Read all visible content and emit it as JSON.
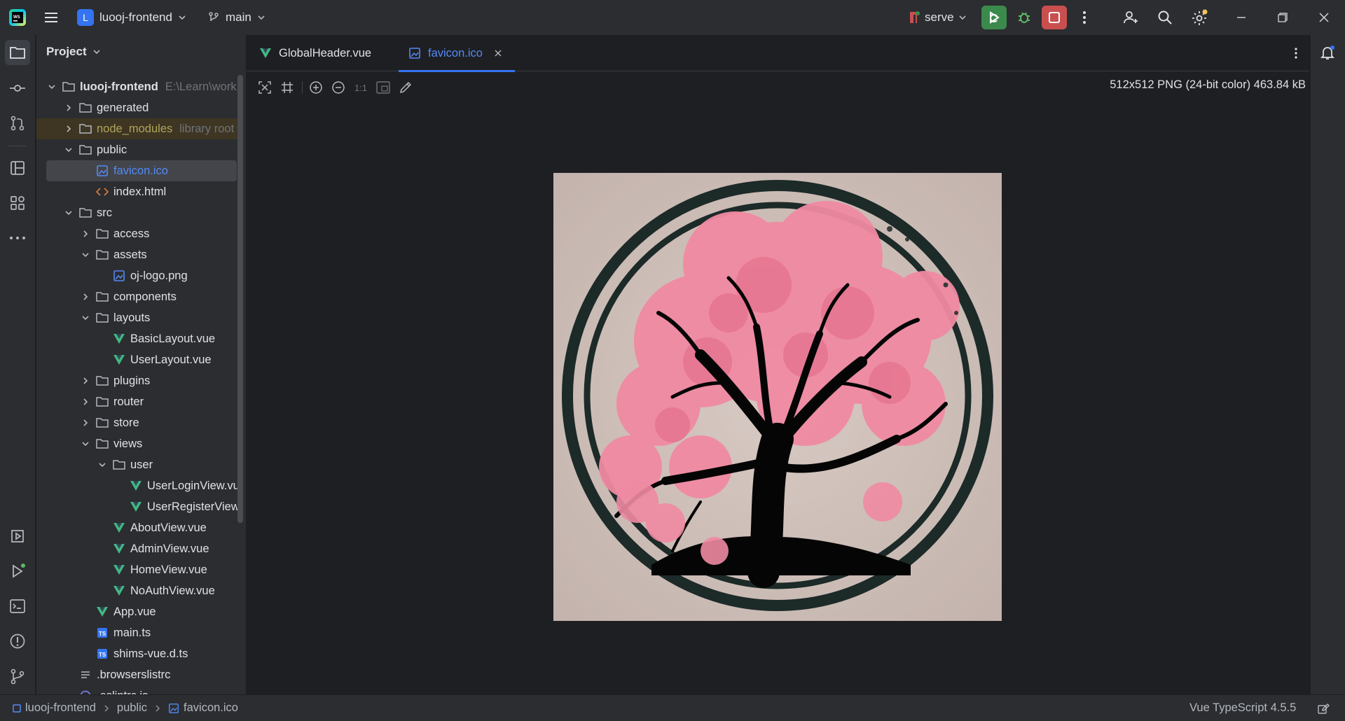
{
  "titlebar": {
    "project_initial": "L",
    "project_name": "luooj-frontend",
    "branch": "main",
    "run_config": "serve"
  },
  "project_panel": {
    "title": "Project",
    "tree": [
      {
        "label": "luooj-frontend",
        "hint": "E:\\Learn\\work",
        "level": 0,
        "type": "folder",
        "expanded": true,
        "bold": true
      },
      {
        "label": "generated",
        "level": 1,
        "type": "folder",
        "expanded": false
      },
      {
        "label": "node_modules",
        "hint": "library root",
        "level": 1,
        "type": "folder",
        "expanded": false,
        "excluded": true
      },
      {
        "label": "public",
        "level": 1,
        "type": "folder",
        "expanded": true
      },
      {
        "label": "favicon.ico",
        "level": 2,
        "type": "image",
        "selected": true
      },
      {
        "label": "index.html",
        "level": 2,
        "type": "html"
      },
      {
        "label": "src",
        "level": 1,
        "type": "folder",
        "expanded": true
      },
      {
        "label": "access",
        "level": 2,
        "type": "folder",
        "expanded": false
      },
      {
        "label": "assets",
        "level": 2,
        "type": "folder",
        "expanded": true
      },
      {
        "label": "oj-logo.png",
        "level": 3,
        "type": "image"
      },
      {
        "label": "components",
        "level": 2,
        "type": "folder",
        "expanded": false
      },
      {
        "label": "layouts",
        "level": 2,
        "type": "folder",
        "expanded": true
      },
      {
        "label": "BasicLayout.vue",
        "level": 3,
        "type": "vue"
      },
      {
        "label": "UserLayout.vue",
        "level": 3,
        "type": "vue"
      },
      {
        "label": "plugins",
        "level": 2,
        "type": "folder",
        "expanded": false
      },
      {
        "label": "router",
        "level": 2,
        "type": "folder",
        "expanded": false
      },
      {
        "label": "store",
        "level": 2,
        "type": "folder",
        "expanded": false
      },
      {
        "label": "views",
        "level": 2,
        "type": "folder",
        "expanded": true
      },
      {
        "label": "user",
        "level": 3,
        "type": "folder",
        "expanded": true
      },
      {
        "label": "UserLoginView.vue",
        "level": 4,
        "type": "vue"
      },
      {
        "label": "UserRegisterView.vue",
        "level": 4,
        "type": "vue"
      },
      {
        "label": "AboutView.vue",
        "level": 3,
        "type": "vue"
      },
      {
        "label": "AdminView.vue",
        "level": 3,
        "type": "vue"
      },
      {
        "label": "HomeView.vue",
        "level": 3,
        "type": "vue"
      },
      {
        "label": "NoAuthView.vue",
        "level": 3,
        "type": "vue"
      },
      {
        "label": "App.vue",
        "level": 2,
        "type": "vue"
      },
      {
        "label": "main.ts",
        "level": 2,
        "type": "ts"
      },
      {
        "label": "shims-vue.d.ts",
        "level": 2,
        "type": "ts"
      },
      {
        "label": ".browserslistrc",
        "level": 1,
        "type": "text"
      },
      {
        "label": ".eslintrc.js",
        "level": 1,
        "type": "js"
      }
    ]
  },
  "editor": {
    "tabs": [
      {
        "label": "GlobalHeader.vue",
        "type": "vue",
        "active": false
      },
      {
        "label": "favicon.ico",
        "type": "image",
        "active": true
      }
    ],
    "toolbar": {
      "actual_size_label": "1:1"
    },
    "image_info": "512x512 PNG (24-bit color) 463.84 kB"
  },
  "statusbar": {
    "breadcrumbs": [
      "luooj-frontend",
      "public",
      "favicon.ico"
    ],
    "language": "Vue TypeScript 4.5.5"
  },
  "colors": {
    "accent": "#3574f0",
    "vue_green": "#41b883",
    "run_green": "#3b8a4c",
    "stop_red": "#c94f4f",
    "blossom_pink": "#f08aa3"
  },
  "icons": {
    "strip_left_top": [
      "folder-icon",
      "commit-icon",
      "pull-requests-icon",
      "structure-icon",
      "plugins-icon",
      "more-icon"
    ],
    "strip_left_bottom": [
      "services-icon",
      "run-icon",
      "terminal-icon",
      "problems-icon",
      "git-icon"
    ]
  }
}
